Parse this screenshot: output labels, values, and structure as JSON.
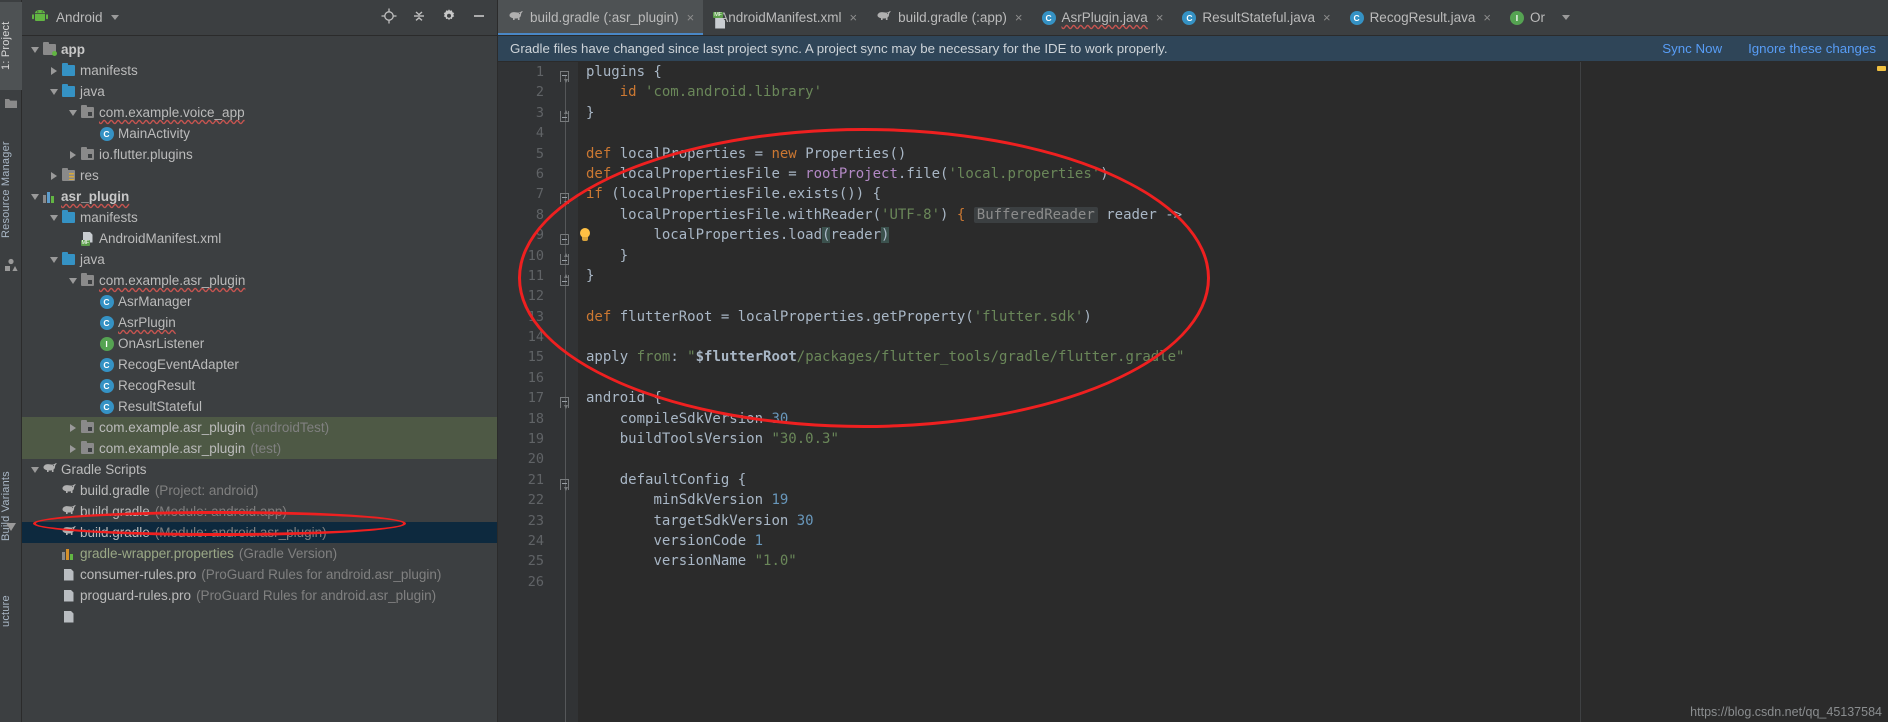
{
  "left_strip": {
    "tabs": [
      {
        "label": "1: Project",
        "icon": "project-icon",
        "selected": true
      },
      {
        "label": "Resource Manager",
        "icon": "resource-manager-icon",
        "selected": false
      },
      {
        "label": "Build Variants",
        "icon": "build-variants-icon",
        "selected": false
      },
      {
        "label": "ucture",
        "icon": "structure-icon",
        "selected": false
      }
    ]
  },
  "project_panel": {
    "header": {
      "title": "Android",
      "dropdown_icon": "chevron-down-icon",
      "actions": [
        {
          "name": "locate-icon"
        },
        {
          "name": "collapse-all-icon"
        },
        {
          "name": "settings-gear-icon"
        },
        {
          "name": "hide-icon"
        }
      ]
    },
    "tree": [
      {
        "indent": 0,
        "arrow": "down",
        "icon": "module-icon",
        "label": "app",
        "bold": true,
        "badge": "green-dot"
      },
      {
        "indent": 1,
        "arrow": "right",
        "icon": "folder-blue",
        "label": "manifests"
      },
      {
        "indent": 1,
        "arrow": "down",
        "icon": "folder-blue",
        "label": "java"
      },
      {
        "indent": 2,
        "arrow": "down",
        "icon": "package-icon",
        "label": "com.example.voice_app",
        "wavy": true
      },
      {
        "indent": 3,
        "arrow": "none",
        "icon": "class-icon",
        "label": "MainActivity"
      },
      {
        "indent": 2,
        "arrow": "right",
        "icon": "package-icon",
        "label": "io.flutter.plugins"
      },
      {
        "indent": 1,
        "arrow": "right",
        "icon": "res-folder-icon",
        "label": "res"
      },
      {
        "indent": 0,
        "arrow": "down",
        "icon": "library-module-icon",
        "label": "asr_plugin",
        "bold": true,
        "wavy": true
      },
      {
        "indent": 1,
        "arrow": "down",
        "icon": "folder-blue",
        "label": "manifests"
      },
      {
        "indent": 2,
        "arrow": "none",
        "icon": "manifest-xml-icon",
        "label": "AndroidManifest.xml"
      },
      {
        "indent": 1,
        "arrow": "down",
        "icon": "folder-blue",
        "label": "java"
      },
      {
        "indent": 2,
        "arrow": "down",
        "icon": "package-icon",
        "label": "com.example.asr_plugin",
        "wavy": true
      },
      {
        "indent": 3,
        "arrow": "none",
        "icon": "class-icon",
        "label": "AsrManager"
      },
      {
        "indent": 3,
        "arrow": "none",
        "icon": "class-icon",
        "label": "AsrPlugin",
        "wavy": true
      },
      {
        "indent": 3,
        "arrow": "none",
        "icon": "interface-icon",
        "label": "OnAsrListener"
      },
      {
        "indent": 3,
        "arrow": "none",
        "icon": "class-icon",
        "label": "RecogEventAdapter"
      },
      {
        "indent": 3,
        "arrow": "none",
        "icon": "class-icon",
        "label": "RecogResult"
      },
      {
        "indent": 3,
        "arrow": "none",
        "icon": "class-icon",
        "label": "ResultStateful"
      },
      {
        "indent": 2,
        "arrow": "right",
        "icon": "package-icon",
        "label": "com.example.asr_plugin",
        "sub": "(androidTest)",
        "highlight": "green"
      },
      {
        "indent": 2,
        "arrow": "right",
        "icon": "package-icon",
        "label": "com.example.asr_plugin",
        "sub": "(test)",
        "highlight": "green"
      },
      {
        "indent": 0,
        "arrow": "down",
        "icon": "gradle-icon",
        "label": "Gradle Scripts"
      },
      {
        "indent": 1,
        "arrow": "none",
        "icon": "gradle-icon",
        "label": "build.gradle",
        "sub": "(Project: android)"
      },
      {
        "indent": 1,
        "arrow": "none",
        "icon": "gradle-icon",
        "label": "build.gradle",
        "sub": "(Module: android.app)"
      },
      {
        "indent": 1,
        "arrow": "none",
        "icon": "gradle-icon",
        "label": "build.gradle",
        "sub": "(Module: android.asr_plugin)",
        "selected": true
      },
      {
        "indent": 1,
        "arrow": "none",
        "icon": "properties-icon",
        "label": "gradle-wrapper.properties",
        "sub": "(Gradle Version)",
        "green_label": true
      },
      {
        "indent": 1,
        "arrow": "none",
        "icon": "file-icon",
        "label": "consumer-rules.pro",
        "sub": "(ProGuard Rules for android.asr_plugin)"
      },
      {
        "indent": 1,
        "arrow": "none",
        "icon": "file-icon",
        "label": "proguard-rules.pro",
        "sub": "(ProGuard Rules for android.asr_plugin)"
      },
      {
        "indent": 1,
        "arrow": "none",
        "icon": "file-icon",
        "label": "",
        "sub": ""
      }
    ]
  },
  "tabs": [
    {
      "label": "build.gradle (:asr_plugin)",
      "icon": "gradle-icon",
      "active": true,
      "close": "×"
    },
    {
      "label": "AndroidManifest.xml",
      "icon": "manifest-xml-icon",
      "active": false,
      "close": "×"
    },
    {
      "label": "build.gradle (:app)",
      "icon": "gradle-icon",
      "active": false,
      "close": "×"
    },
    {
      "label": "AsrPlugin.java",
      "icon": "class-icon",
      "active": false,
      "close": "×",
      "wavy": true
    },
    {
      "label": "ResultStateful.java",
      "icon": "class-icon",
      "active": false,
      "close": "×"
    },
    {
      "label": "RecogResult.java",
      "icon": "class-icon",
      "active": false,
      "close": "×"
    },
    {
      "label": "Or",
      "icon": "interface-icon",
      "active": false,
      "close": ""
    }
  ],
  "tab_overflow_icon": "chevron-down-icon",
  "notification": {
    "message": "Gradle files have changed since last project sync. A project sync may be necessary for the IDE to work properly.",
    "sync_now": "Sync Now",
    "ignore": "Ignore these changes",
    "bg_color": "#2f4558",
    "link_color": "#589df6"
  },
  "editor": {
    "file": "build.gradle",
    "lines": [
      {
        "n": 1,
        "fold": "topdown",
        "text": "plugins {",
        "indent": 0
      },
      {
        "n": 2,
        "fold": "",
        "text": "    id 'com.android.library'",
        "indent": 0
      },
      {
        "n": 3,
        "fold": "bottomup",
        "text": "}",
        "indent": 0
      },
      {
        "n": 4,
        "fold": "",
        "text": "",
        "indent": 0
      },
      {
        "n": 5,
        "fold": "",
        "text": "def localProperties = new Properties()",
        "indent": 0
      },
      {
        "n": 6,
        "fold": "",
        "text": "def localPropertiesFile = rootProject.file('local.properties')",
        "indent": 0
      },
      {
        "n": 7,
        "fold": "topdown",
        "text": "if (localPropertiesFile.exists()) {",
        "indent": 0
      },
      {
        "n": 8,
        "fold": "",
        "text": "    localPropertiesFile.withReader('UTF-8') {  BufferedReader  reader ->",
        "indent": 0
      },
      {
        "n": 9,
        "fold": "minus",
        "text": "        localProperties.load(reader)",
        "indent": 0,
        "bulb": true
      },
      {
        "n": 10,
        "fold": "bottomup",
        "text": "    }",
        "indent": 0
      },
      {
        "n": 11,
        "fold": "bottomup",
        "text": "}",
        "indent": 0
      },
      {
        "n": 12,
        "fold": "",
        "text": "",
        "indent": 0
      },
      {
        "n": 13,
        "fold": "",
        "text": "def flutterRoot = localProperties.getProperty('flutter.sdk')",
        "indent": 0
      },
      {
        "n": 14,
        "fold": "",
        "text": "",
        "indent": 0
      },
      {
        "n": 15,
        "fold": "",
        "text": "apply from: \"$flutterRoot/packages/flutter_tools/gradle/flutter.gradle\"",
        "indent": 0
      },
      {
        "n": 16,
        "fold": "",
        "text": "",
        "indent": 0
      },
      {
        "n": 17,
        "fold": "topdown",
        "text": "android {",
        "indent": 0
      },
      {
        "n": 18,
        "fold": "",
        "text": "    compileSdkVersion 30",
        "indent": 0
      },
      {
        "n": 19,
        "fold": "",
        "text": "    buildToolsVersion \"30.0.3\"",
        "indent": 0
      },
      {
        "n": 20,
        "fold": "",
        "text": "",
        "indent": 0
      },
      {
        "n": 21,
        "fold": "topdown",
        "text": "    defaultConfig {",
        "indent": 0
      },
      {
        "n": 22,
        "fold": "",
        "text": "        minSdkVersion 19",
        "indent": 0
      },
      {
        "n": 23,
        "fold": "",
        "text": "        targetSdkVersion 30",
        "indent": 0
      },
      {
        "n": 24,
        "fold": "",
        "text": "        versionCode 1",
        "indent": 0
      },
      {
        "n": 25,
        "fold": "",
        "text": "        versionName \"1.0\"",
        "indent": 0
      },
      {
        "n": 26,
        "fold": "",
        "text": "",
        "indent": 0
      }
    ]
  },
  "annotations": {
    "ellipse_code": {
      "note": "red ellipse around lines 5-17 in editor"
    },
    "ellipse_tree": {
      "note": "red ellipse around build.gradle (Module: android.asr_plugin)"
    },
    "color": "#ef2020"
  },
  "watermark": "https://blog.csdn.net/qq_45137584"
}
